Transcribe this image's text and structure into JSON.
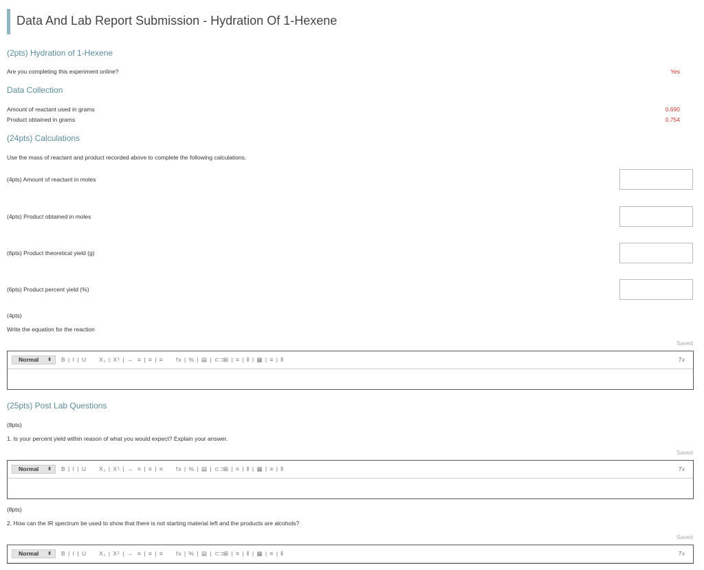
{
  "page_title": "Data And Lab Report Submission - Hydration Of 1-Hexene",
  "sections": {
    "hydration": {
      "title": "(2pts) Hydration of 1-Hexene",
      "question": "Are you completing this experiment online?",
      "answer": "Yes"
    },
    "data_collection": {
      "title": "Data Collection",
      "rows": [
        {
          "label": "Amount of reactant used in grams",
          "value": "0.690"
        },
        {
          "label": "Product obtained in grams",
          "value": "0.754"
        }
      ]
    },
    "calculations": {
      "title": "(24pts) Calculations",
      "intro": "Use the mass of reactant and product recorded above to complete the following calculations.",
      "items": [
        {
          "label": "(4pts)  Amount of reactant in moles",
          "value": ""
        },
        {
          "label": "(4pts)  Product obtained in moles",
          "value": ""
        },
        {
          "label": "(6pts)  Product theoretical yield (g)",
          "value": ""
        },
        {
          "label": "(6pts)  Product percent yield (%)",
          "value": ""
        }
      ],
      "equation_points": "(4pts)",
      "equation_prompt": "Write the equation for the reaction"
    },
    "post_lab": {
      "title": "(25pts) Post Lab Questions",
      "q1_points": "(8pts)",
      "q1": "1. Is your percent yield within reason of what you would expect? Explain your answer.",
      "q2_points": "(8pts)",
      "q2": "2. How can the IR spectrum be used to show that there is not starting material left and the products are alcohols?"
    }
  },
  "editor": {
    "saved_label": "Saved",
    "format_value": "Normal",
    "format_arrow": "⬍",
    "toolbar_text": {
      "style": "B | I | U",
      "script": "X₁ | X¹ | →",
      "lists": "≡ | ≡ | ≡",
      "insert": "fx | % | ▤ | ⊂⊃",
      "table": "⊞ | ≡ | ⫴ | ▦ | ≡ | ⫴",
      "clear": "Tx"
    }
  }
}
